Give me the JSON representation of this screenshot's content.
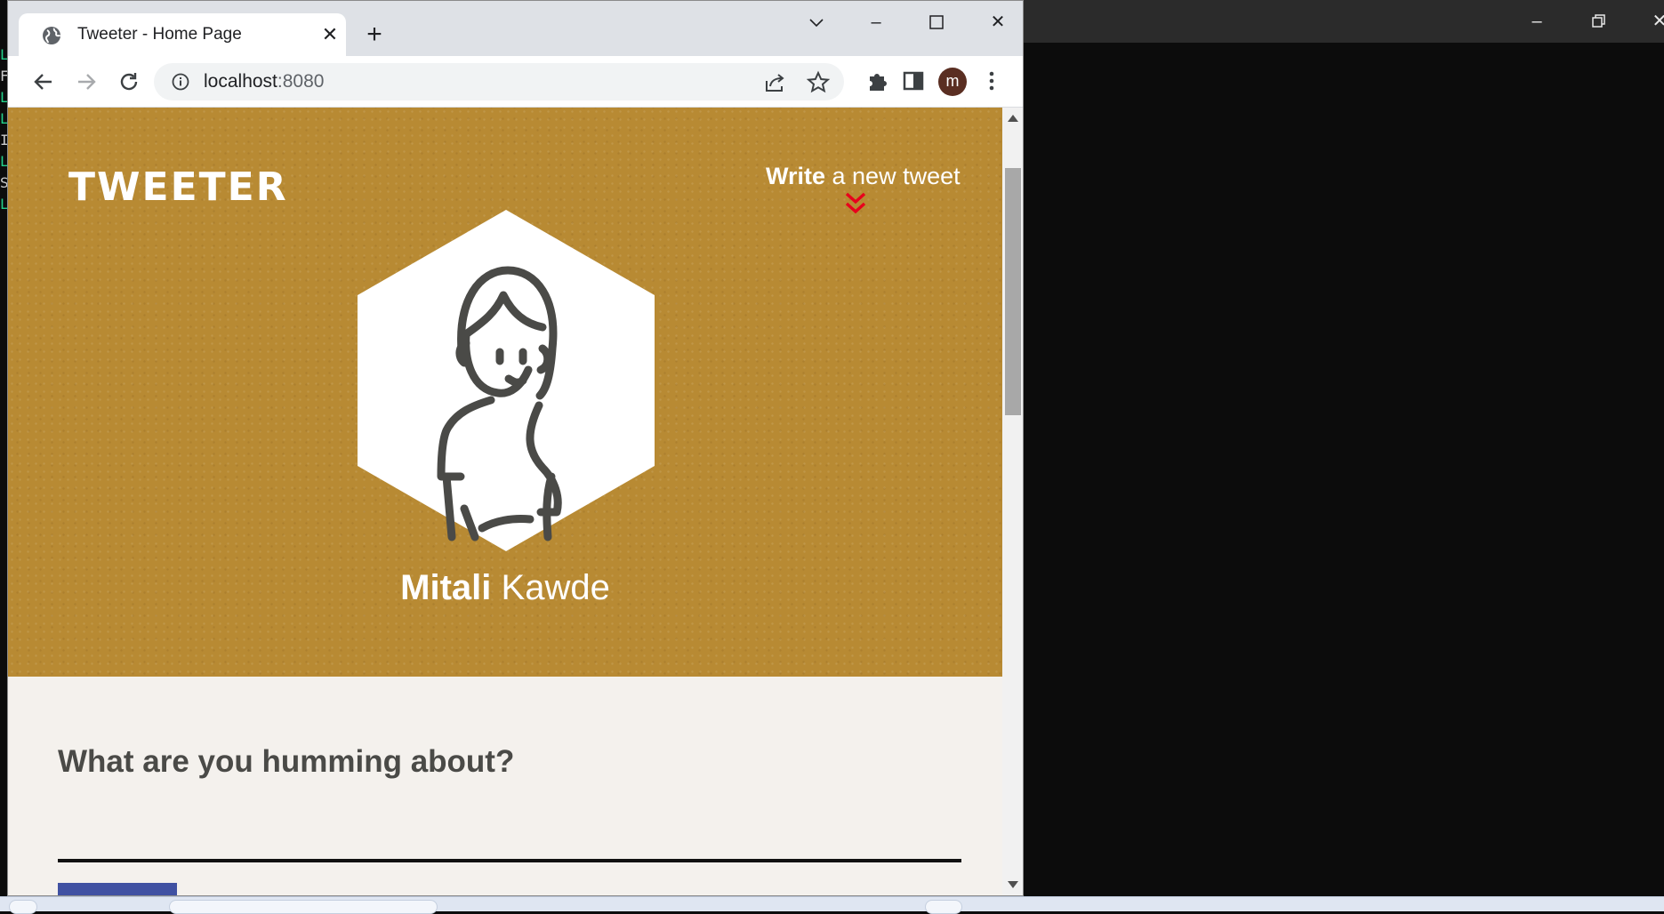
{
  "browser": {
    "tab_title": "Tweeter - Home Page",
    "url_host": "localhost",
    "url_port": ":8080",
    "profile_initial": "m"
  },
  "page": {
    "logo": "TWEETER",
    "write_strong": "Write",
    "write_rest": " a new tweet",
    "user_first": "Mitali",
    "user_last": " Kawde",
    "compose_heading": "What are you humming about?"
  },
  "icons": [
    "globe-icon",
    "close-icon",
    "plus-icon",
    "chevron-down-icon",
    "minimize-icon",
    "maximize-icon",
    "back-arrow-icon",
    "forward-arrow-icon",
    "reload-icon",
    "info-icon",
    "share-icon",
    "star-icon",
    "puzzle-icon",
    "side-panel-icon",
    "more-vert-icon",
    "double-chevron-down-icon",
    "restore-icon"
  ],
  "colors": {
    "hero": "#b88a33",
    "accent_chevron": "#e8001c",
    "page_bg": "#f4f1ed",
    "tweet_button": "#4051a2"
  }
}
